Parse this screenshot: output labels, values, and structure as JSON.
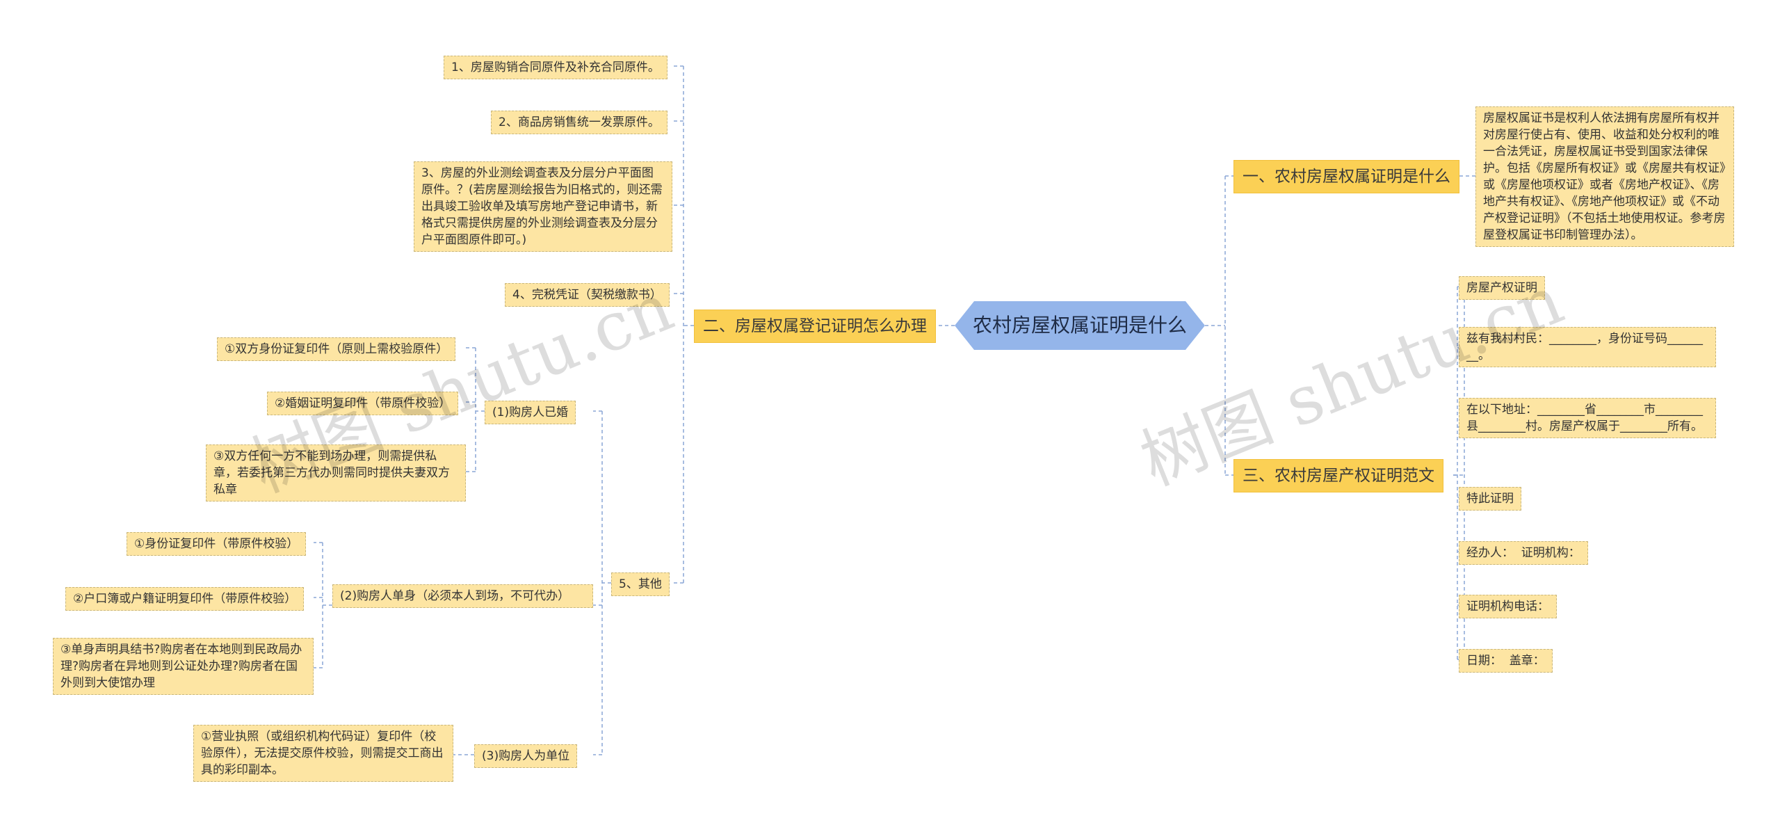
{
  "root": {
    "label": "农村房屋权属证明是什么"
  },
  "branches": {
    "b1": "一、农村房屋权属证明是什么",
    "b2": "二、房屋权属登记证明怎么办理",
    "b3": "三、农村房屋产权证明范文"
  },
  "b1_children": {
    "desc": "房屋权属证书是权利人依法拥有房屋所有权并对房屋行使占有、使用、收益和处分权利的唯一合法凭证，房屋权属证书受到国家法律保护。包括《房屋所有权证》或《房屋共有权证》或《房屋他项权证》或者《房地产权证》、《房地产共有权证》、《房地产他项权证》或《不动产权登记证明》（不包括土地使用权证。参考房屋登权属证书印制管理办法）。"
  },
  "b2_children": {
    "i1": "1、房屋购销合同原件及补充合同原件。",
    "i2": "2、商品房销售统一发票原件。",
    "i3": "3、房屋的外业测绘调查表及分层分户平面图原件。？(若房屋测绘报告为旧格式的，则还需出具竣工验收单及填写房地产登记申请书，新格式只需提供房屋的外业测绘调查表及分层分户平面图原件即可。)",
    "i4": "4、完税凭证（契税缴款书）",
    "i5": "5、其他",
    "married": {
      "label": "(1)购房人已婚",
      "items": [
        "①双方身份证复印件（原则上需校验原件）",
        "②婚姻证明复印件（带原件校验）",
        "③双方任何一方不能到场办理，则需提供私章，若委托第三方代办则需同时提供夫妻双方私章"
      ]
    },
    "single": {
      "label": "(2)购房人单身（必须本人到场，不可代办）",
      "items": [
        "①身份证复印件（带原件校验）",
        "②户口簿或户籍证明复印件（带原件校验）",
        "③单身声明具结书?购房者在本地则到民政局办理?购房者在异地则到公证处办理?购房者在国外则到大使馆办理"
      ]
    },
    "unit": {
      "label": "(3)购房人为单位",
      "items": [
        "①营业执照（或组织机构代码证）复印件（校验原件），无法提交原件校验，则需提交工商出具的彩印副本。"
      ]
    }
  },
  "b3_children": {
    "items": [
      "房屋产权证明",
      "兹有我村村民：________，身份证号码________。",
      "在以下地址：________省________市________县________村。房屋产权属于________所有。",
      "特此证明",
      "经办人：  证明机构：",
      "证明机构电话：",
      "日期：  盖章："
    ]
  },
  "watermarks": [
    "树图 shutu.cn",
    "树图 shutu.cn"
  ],
  "colors": {
    "root_fill": "#94b5ea",
    "branch_fill": "#fbd055",
    "leaf_fill": "#fde5a3",
    "connector": "#8aa6d6"
  }
}
